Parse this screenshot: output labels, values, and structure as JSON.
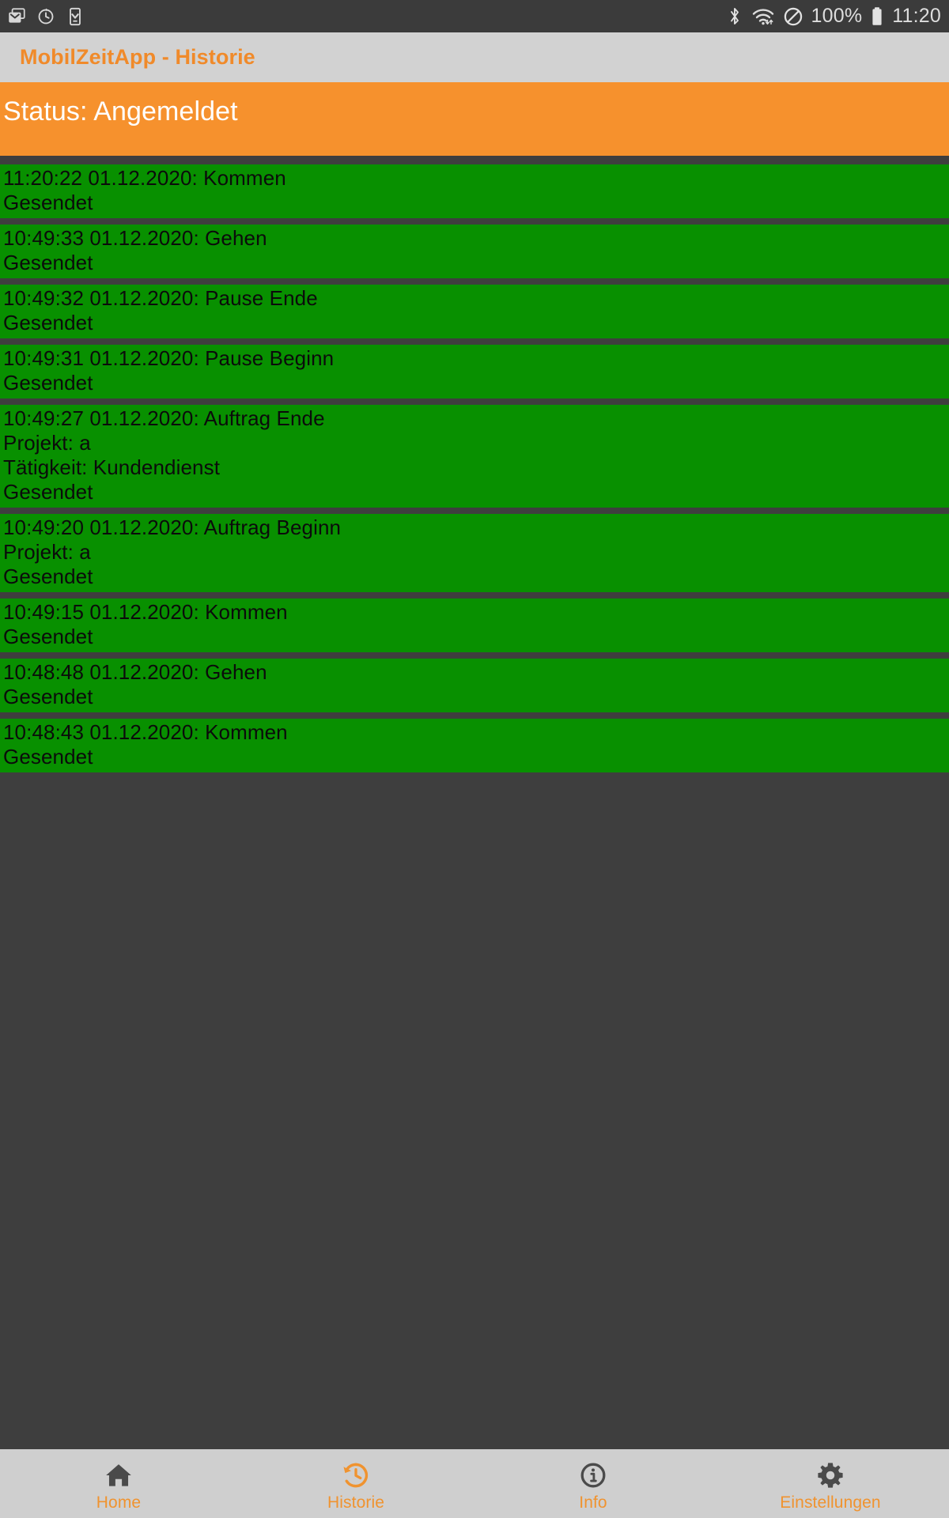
{
  "status_bar": {
    "left_icons": [
      "email-icon",
      "alarm-history-icon",
      "device-check-icon"
    ],
    "right_icons": [
      "bluetooth-icon",
      "wifi-icon",
      "do-not-disturb-icon",
      "battery-icon"
    ],
    "battery_percent": "100%",
    "clock": "11:20"
  },
  "title_bar": {
    "title": "MobilZeitApp - Historie"
  },
  "status_banner": {
    "text": "Status: Angemeldet"
  },
  "colors": {
    "accent_orange": "#f6912d",
    "title_orange": "#f08a2a",
    "entry_green": "#089000",
    "background_dark": "#3e3e3e",
    "bar_gray": "#d2d2d2",
    "nav_gray": "#cfcfcf",
    "icon_dark": "#4a4a4a"
  },
  "history": {
    "entries": [
      {
        "lines": [
          "11:20:22 01.12.2020: Kommen",
          "Gesendet"
        ]
      },
      {
        "lines": [
          "10:49:33 01.12.2020: Gehen",
          "Gesendet"
        ]
      },
      {
        "lines": [
          "10:49:32 01.12.2020: Pause Ende",
          "Gesendet"
        ]
      },
      {
        "lines": [
          "10:49:31 01.12.2020: Pause Beginn",
          "Gesendet"
        ]
      },
      {
        "lines": [
          "10:49:27 01.12.2020: Auftrag Ende",
          "Projekt: a",
          "Tätigkeit: Kundendienst",
          "Gesendet"
        ]
      },
      {
        "lines": [
          "10:49:20 01.12.2020: Auftrag Beginn",
          "Projekt: a",
          "Gesendet"
        ]
      },
      {
        "lines": [
          "10:49:15 01.12.2020: Kommen",
          "Gesendet"
        ]
      },
      {
        "lines": [
          "10:48:48 01.12.2020: Gehen",
          "Gesendet"
        ]
      },
      {
        "lines": [
          "10:48:43 01.12.2020: Kommen",
          "Gesendet"
        ]
      }
    ]
  },
  "bottom_nav": {
    "items": [
      {
        "label": "Home",
        "icon": "home-icon",
        "active": false
      },
      {
        "label": "Historie",
        "icon": "history-clock-icon",
        "active": true
      },
      {
        "label": "Info",
        "icon": "info-circle-icon",
        "active": false
      },
      {
        "label": "Einstellungen",
        "icon": "gear-icon",
        "active": false
      }
    ]
  }
}
